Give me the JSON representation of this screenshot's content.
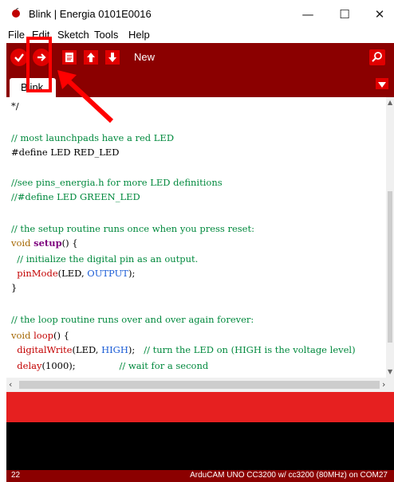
{
  "window": {
    "title": "Blink | Energia 0101E0016",
    "minimize": "—",
    "maximize": "☐",
    "close": "✕"
  },
  "menu": [
    "File",
    "Edit",
    "Sketch",
    "Tools",
    "Help"
  ],
  "toolbar": {
    "new_label": "New",
    "verify_icon": "check-icon",
    "upload_icon": "arrow-right-icon",
    "new_icon": "document-icon",
    "open_icon": "arrow-up-icon",
    "save_icon": "arrow-down-icon",
    "serial_icon": "magnifier-icon"
  },
  "tabs": [
    {
      "label": "Blink"
    }
  ],
  "code": [
    "*/",
    "",
    "// most launchpads have a red LED",
    "#define LED RED_LED",
    "",
    "//see pins_energia.h for more LED definitions",
    "//#define LED GREEN_LED",
    "",
    "// the setup routine runs once when you press reset:",
    "void setup() {",
    "  // initialize the digital pin as an output.",
    "  pinMode(LED, OUTPUT);",
    "}",
    "",
    "// the loop routine runs over and over again forever:",
    "void loop() {",
    "  digitalWrite(LED, HIGH);   // turn the LED on (HIGH is the voltage level)",
    "  delay(1000);               // wait for a second"
  ],
  "status": {
    "line": "22",
    "board": "ArduCAM UNO CC3200 w/ cc3200 (80MHz) on COM27"
  },
  "colors": {
    "toolbar": "#8b0000",
    "button": "#e00000",
    "console_status": "#e62020",
    "annotation": "#ff0000"
  }
}
